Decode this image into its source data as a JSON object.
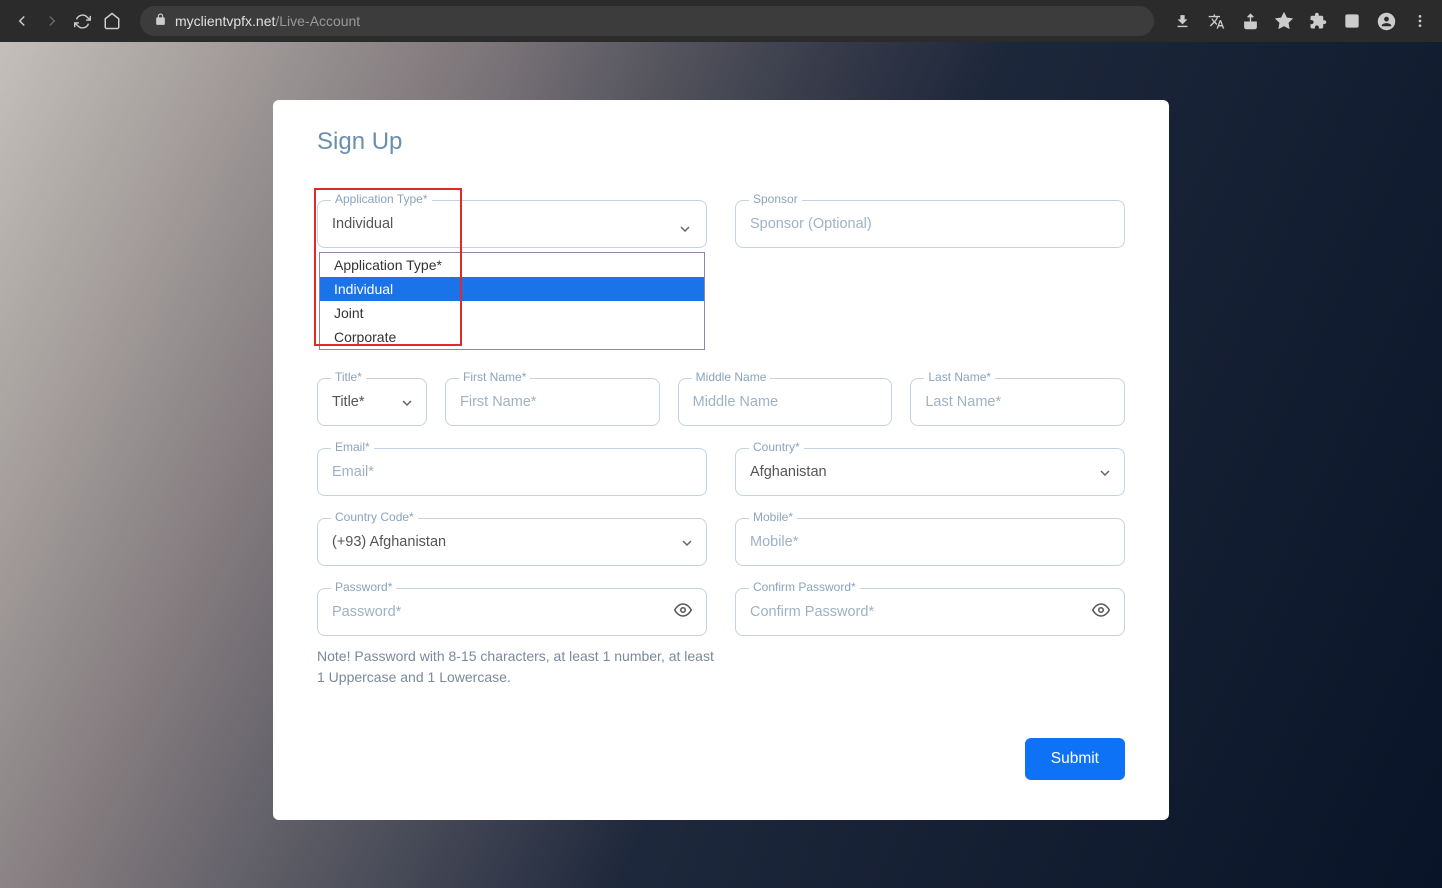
{
  "browser": {
    "url_domain": "myclientvpfx.net",
    "url_path": "/Live-Account"
  },
  "form": {
    "title": "Sign Up",
    "application_type": {
      "label": "Application Type*",
      "value": "Individual",
      "options": [
        "Application Type*",
        "Individual",
        "Joint",
        "Corporate"
      ]
    },
    "sponsor": {
      "label": "Sponsor",
      "placeholder": "Sponsor (Optional)"
    },
    "title_field": {
      "label": "Title*",
      "value": "Title*"
    },
    "first_name": {
      "label": "First Name*",
      "placeholder": "First Name*"
    },
    "middle_name": {
      "label": "Middle Name",
      "placeholder": "Middle Name"
    },
    "last_name": {
      "label": "Last Name*",
      "placeholder": "Last Name*"
    },
    "email": {
      "label": "Email*",
      "placeholder": "Email*"
    },
    "country": {
      "label": "Country*",
      "value": "Afghanistan"
    },
    "country_code": {
      "label": "Country Code*",
      "value": "(+93) Afghanistan"
    },
    "mobile": {
      "label": "Mobile*",
      "placeholder": "Mobile*"
    },
    "password": {
      "label": "Password*",
      "placeholder": "Password*"
    },
    "confirm_password": {
      "label": "Confirm Password*",
      "placeholder": "Confirm Password*"
    },
    "note": "Note! Password with 8-15 characters, at least 1 number, at least 1 Uppercase and 1 Lowercase.",
    "submit": "Submit"
  }
}
